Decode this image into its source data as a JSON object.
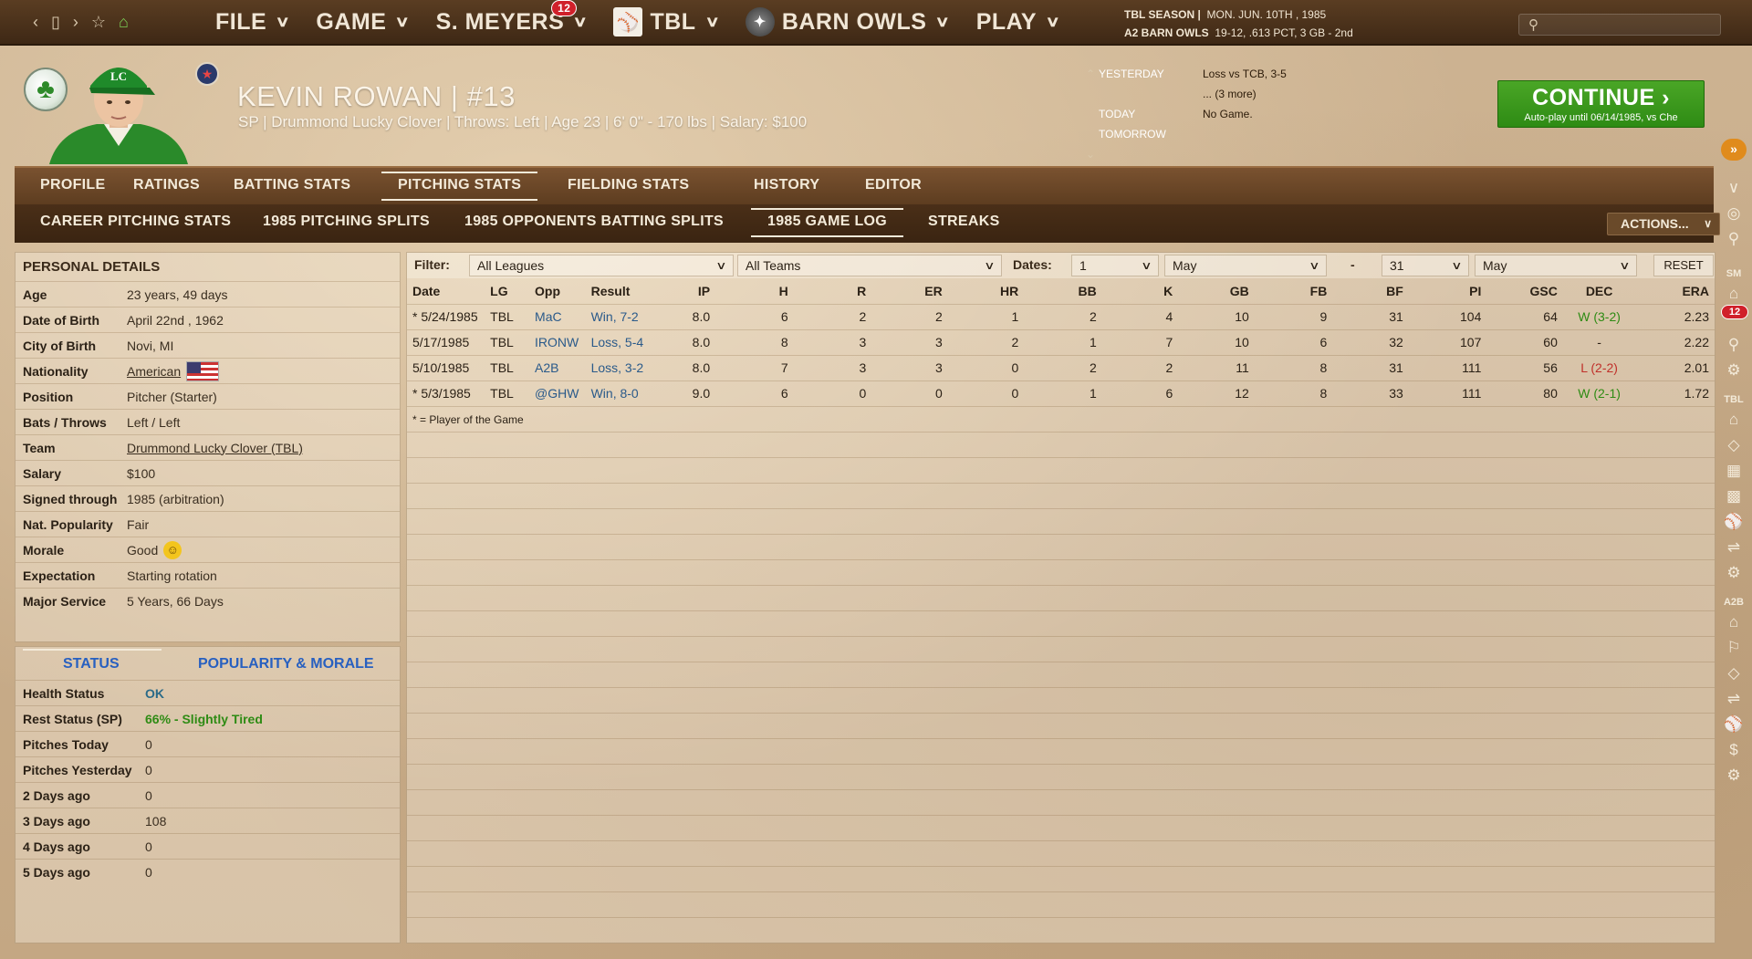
{
  "topbar": {
    "nav_icons": [
      "back-icon",
      "page-icon",
      "forward-icon",
      "star-icon",
      "home-icon"
    ],
    "menu": [
      {
        "label": "FILE"
      },
      {
        "label": "GAME"
      },
      {
        "label": "S. MEYERS",
        "badge": "12"
      },
      {
        "label": "TBL",
        "icon": "pitcher-logo-icon"
      },
      {
        "label": "BARN OWLS",
        "icon": "barn-owls-logo-icon"
      },
      {
        "label": "PLAY"
      }
    ],
    "season_line1": "TBL SEASON",
    "season_line1_date": "MON. JUN. 10TH , 1985",
    "season_line2": "A2 BARN OWLS",
    "season_line2_stats": "19-12, .613 PCT, 3 GB - 2nd",
    "search_placeholder": ""
  },
  "player": {
    "cap_letters": "LC",
    "name": "KEVIN ROWAN  |  #13",
    "sub": "SP | Drummond Lucky Clover  |  Throws: Left  |  Age 23  |  6' 0\" - 170 lbs  |  Salary: $100"
  },
  "schedule": {
    "rows": [
      {
        "label": "YESTERDAY",
        "value": "Loss vs TCB, 3-5"
      },
      {
        "label": "",
        "value": "... (3 more)"
      },
      {
        "label": "TODAY",
        "value": "No Game."
      },
      {
        "label": "TOMORROW",
        "value": ""
      }
    ]
  },
  "continue": {
    "label": "CONTINUE",
    "sub": "Auto-play until 06/14/1985, vs Che"
  },
  "tabs_main": [
    "PROFILE",
    "RATINGS",
    "BATTING STATS",
    "PITCHING STATS",
    "FIELDING STATS",
    "HISTORY",
    "EDITOR"
  ],
  "tabs_main_active": "PITCHING STATS",
  "tabs_sub": [
    "CAREER PITCHING STATS",
    "1985 PITCHING SPLITS",
    "1985 OPPONENTS BATTING SPLITS",
    "1985 GAME LOG",
    "STREAKS"
  ],
  "tabs_sub_active": "1985 GAME LOG",
  "actions_label": "ACTIONS...",
  "personal": {
    "title": "PERSONAL DETAILS",
    "rows": [
      {
        "k": "Age",
        "v": "23 years, 49 days"
      },
      {
        "k": "Date of Birth",
        "v": "April 22nd , 1962"
      },
      {
        "k": "City of Birth",
        "v": "Novi, MI"
      },
      {
        "k": "Nationality",
        "v": "American"
      },
      {
        "k": "Position",
        "v": "Pitcher (Starter)"
      },
      {
        "k": "Bats / Throws",
        "v": "Left / Left"
      },
      {
        "k": "Team",
        "v": "Drummond Lucky Clover (TBL)"
      },
      {
        "k": "Salary",
        "v": "$100"
      },
      {
        "k": "Signed through",
        "v": "1985 (arbitration)"
      },
      {
        "k": "Nat. Popularity",
        "v": "Fair"
      },
      {
        "k": "Morale",
        "v": "Good"
      },
      {
        "k": "Expectation",
        "v": "Starting rotation"
      },
      {
        "k": "Major Service",
        "v": "5 Years, 66 Days"
      }
    ]
  },
  "status": {
    "tabs": [
      "STATUS",
      "POPULARITY & MORALE"
    ],
    "rows": [
      {
        "k": "Health Status",
        "v": "OK"
      },
      {
        "k": "Rest Status (SP)",
        "v": "66% - Slightly Tired"
      },
      {
        "k": "Pitches Today",
        "v": "0"
      },
      {
        "k": "Pitches Yesterday",
        "v": "0"
      },
      {
        "k": "2 Days ago",
        "v": "0"
      },
      {
        "k": "3 Days ago",
        "v": "108"
      },
      {
        "k": "4 Days ago",
        "v": "0"
      },
      {
        "k": "5 Days ago",
        "v": "0"
      }
    ]
  },
  "filter": {
    "label": "Filter:",
    "league": "All Leagues",
    "team": "All Teams",
    "dates_label": "Dates:",
    "from_day": "1",
    "from_month": "May",
    "dash": "-",
    "to_day": "31",
    "to_month": "May",
    "reset": "RESET"
  },
  "gamelog": {
    "columns": [
      "Date",
      "LG",
      "Opp",
      "Result",
      "IP",
      "H",
      "R",
      "ER",
      "HR",
      "BB",
      "K",
      "GB",
      "FB",
      "BF",
      "PI",
      "GSC",
      "DEC",
      "ERA"
    ],
    "rows": [
      [
        "* 5/24/1985",
        "TBL",
        "MaC",
        "Win, 7-2",
        "8.0",
        "6",
        "2",
        "2",
        "1",
        "2",
        "4",
        "10",
        "9",
        "31",
        "104",
        "64",
        "W (3-2)",
        "2.23"
      ],
      [
        "5/17/1985",
        "TBL",
        "IRONW",
        "Loss, 5-4",
        "8.0",
        "8",
        "3",
        "3",
        "2",
        "1",
        "7",
        "10",
        "6",
        "32",
        "107",
        "60",
        "-",
        "2.22"
      ],
      [
        "5/10/1985",
        "TBL",
        "A2B",
        "Loss, 3-2",
        "8.0",
        "7",
        "3",
        "3",
        "0",
        "2",
        "2",
        "11",
        "8",
        "31",
        "111",
        "56",
        "L (2-2)",
        "2.01"
      ],
      [
        "* 5/3/1985",
        "TBL",
        "@GHW",
        "Win, 8-0",
        "9.0",
        "6",
        "0",
        "0",
        "0",
        "1",
        "6",
        "12",
        "8",
        "33",
        "111",
        "80",
        "W (2-1)",
        "1.72"
      ]
    ],
    "footnote": "* = Player of the Game"
  },
  "right_sidebar": {
    "labels": [
      "SM",
      "TBL",
      "A2B"
    ],
    "badge": "12"
  },
  "colors": {
    "accent_green": "#2e8b14",
    "loss_red": "#c0302a",
    "link_blue": "#2a5a8a",
    "header_brown": "#5a3d22"
  }
}
